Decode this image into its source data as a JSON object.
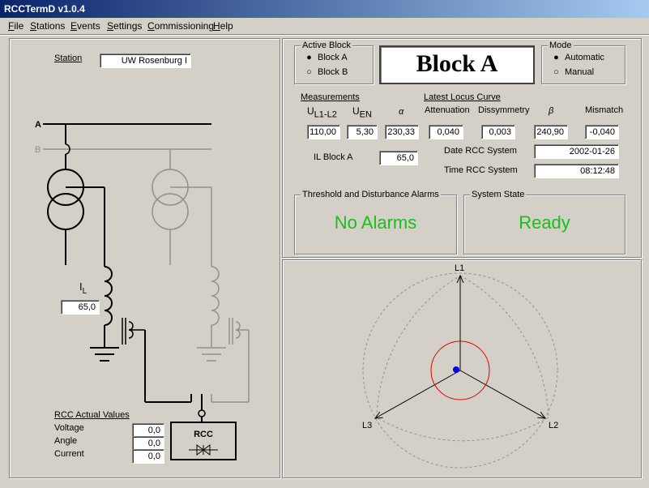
{
  "window": {
    "title": "RCCTermD  v1.0.4"
  },
  "menu": [
    "File",
    "Stations",
    "Events",
    "Settings",
    "Commissioning",
    "Help"
  ],
  "station": {
    "label": "Station",
    "value": "UW Rosenburg I"
  },
  "diagram": {
    "bus_a": "A",
    "bus_b": "B",
    "il_label": "I",
    "il_sub": "L",
    "il_value": "65,0",
    "rcc_label": "RCC"
  },
  "rcc_actual": {
    "title": "RCC Actual Values",
    "rows": [
      {
        "label": "Voltage",
        "value": "0,0"
      },
      {
        "label": "Angle",
        "value": "0,0"
      },
      {
        "label": "Current",
        "value": "0,0"
      }
    ]
  },
  "active_block": {
    "title": "Active Block",
    "options": [
      "Block A",
      "Block B"
    ],
    "selected": "Block A"
  },
  "block_display": "Block A",
  "mode": {
    "title": "Mode",
    "options": [
      "Automatic",
      "Manual"
    ],
    "selected": "Automatic"
  },
  "measurements": {
    "title": "Measurements",
    "u_l1l2_label": "U",
    "u_l1l2_sub": "L1-L2",
    "u_l1l2_value": "110,00",
    "u_en_label": "U",
    "u_en_sub": "EN",
    "u_en_value": "5,30",
    "alpha_label": "α",
    "alpha_value": "230,33",
    "il_block_label": "IL Block A",
    "il_block_value": "65,0"
  },
  "locus": {
    "title": "Latest Locus Curve",
    "attenuation_label": "Attenuation",
    "attenuation_value": "0,040",
    "dissymmetry_label": "Dissymmetry",
    "dissymmetry_value": "0,003",
    "beta_label": "β",
    "beta_value": "240,90",
    "mismatch_label": "Mismatch",
    "mismatch_value": "-0,040",
    "date_label": "Date RCC System",
    "date_value": "2002-01-26",
    "time_label": "Time RCC System",
    "time_value": "08:12:48"
  },
  "alarms": {
    "title": "Threshold and Disturbance Alarms",
    "status": "No Alarms"
  },
  "system_state": {
    "title": "System State",
    "status": "Ready"
  },
  "phasor": {
    "l1": "L1",
    "l2": "L2",
    "l3": "L3"
  },
  "colors": {
    "status_green": "#18c018",
    "circle_red": "#e00000",
    "dot_blue": "#0000e0",
    "title_bar": "#0a246a"
  }
}
